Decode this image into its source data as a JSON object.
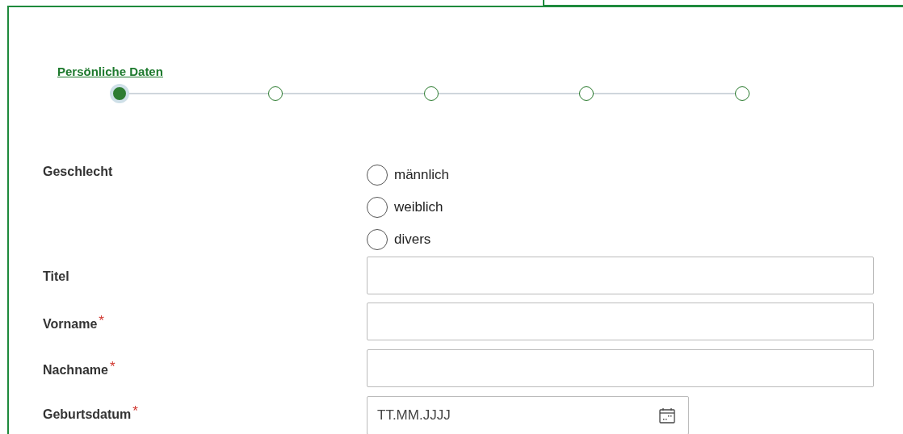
{
  "stepper": {
    "label": "Persönliche Daten",
    "steps": [
      {
        "selected": true
      },
      {
        "selected": false
      },
      {
        "selected": false
      },
      {
        "selected": false
      },
      {
        "selected": false
      }
    ]
  },
  "fields": [
    {
      "kind": "radio",
      "label": "Geschlecht",
      "options": [
        {
          "label": "männlich",
          "selected": false
        },
        {
          "label": "weiblich",
          "selected": false
        },
        {
          "label": "divers",
          "selected": false
        }
      ]
    },
    {
      "kind": "text",
      "label": "Titel"
    },
    {
      "kind": "text",
      "label": "Vorname",
      "required_mark": "*"
    },
    {
      "kind": "text",
      "label": "Nachname",
      "required_mark": "*"
    },
    {
      "kind": "date",
      "label": "Geburtsdatum",
      "required_mark": "*",
      "placeholder": "TT.MM.JJJJ"
    }
  ]
}
